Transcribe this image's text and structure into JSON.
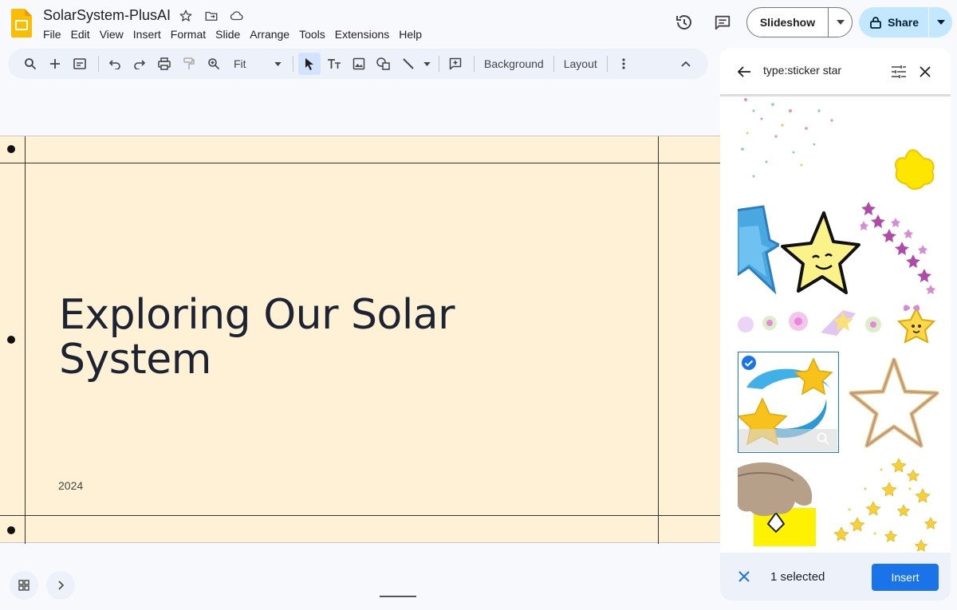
{
  "document": {
    "title": "SolarSystem-PlusAI"
  },
  "menu": [
    {
      "label": "File"
    },
    {
      "label": "Edit"
    },
    {
      "label": "View"
    },
    {
      "label": "Insert"
    },
    {
      "label": "Format"
    },
    {
      "label": "Slide"
    },
    {
      "label": "Arrange"
    },
    {
      "label": "Tools"
    },
    {
      "label": "Extensions"
    },
    {
      "label": "Help"
    }
  ],
  "header_actions": {
    "slideshow_label": "Slideshow",
    "share_label": "Share"
  },
  "toolbar": {
    "zoom_value": "Fit",
    "background_label": "Background",
    "layout_label": "Layout"
  },
  "slide": {
    "title": "Exploring Our Solar System",
    "subtitle": "2024",
    "background_color": "#fff1d6"
  },
  "image_search_panel": {
    "query": "type:sticker star",
    "selected_count_text": "1 selected",
    "insert_label": "Insert",
    "results": [
      {
        "icon": "scattered-confetti-stars"
      },
      {
        "icon": "yellow-puffy-star"
      },
      {
        "icon": "blue-star-outline"
      },
      {
        "icon": "smiling-yellow-star"
      },
      {
        "icon": "pink-star-trail"
      },
      {
        "icon": "fuzzy-star-strip"
      },
      {
        "icon": "star-with-bow"
      },
      {
        "icon": "shooting-stars-blue-swoosh",
        "selected": true
      },
      {
        "icon": "gold-star-outline"
      },
      {
        "icon": "hand-holding-sticker"
      },
      {
        "icon": "falling-gold-stars"
      }
    ]
  },
  "colors": {
    "accent": "#1a73e8",
    "share_bg": "#c2e7ff",
    "toolbar_bg": "#edf2fa"
  }
}
